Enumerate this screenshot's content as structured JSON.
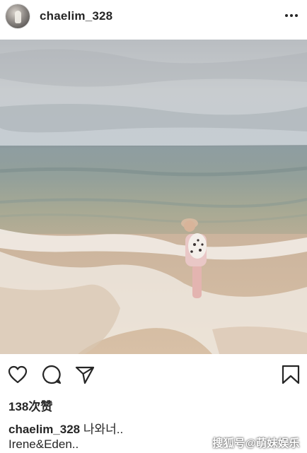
{
  "post": {
    "username": "chaelim_328",
    "likes": "138次赞",
    "caption_user": "chaelim_328",
    "caption_text": "나와너..",
    "caption_line2": "Irene&Eden.."
  },
  "icons": {
    "more": "more-options-icon",
    "like": "heart-icon",
    "comment": "comment-icon",
    "share": "share-icon",
    "save": "bookmark-icon"
  },
  "watermark": "搜狐号@萌妹娱乐",
  "colors": {
    "text": "#262626",
    "icon": "#262626",
    "background": "#ffffff"
  }
}
